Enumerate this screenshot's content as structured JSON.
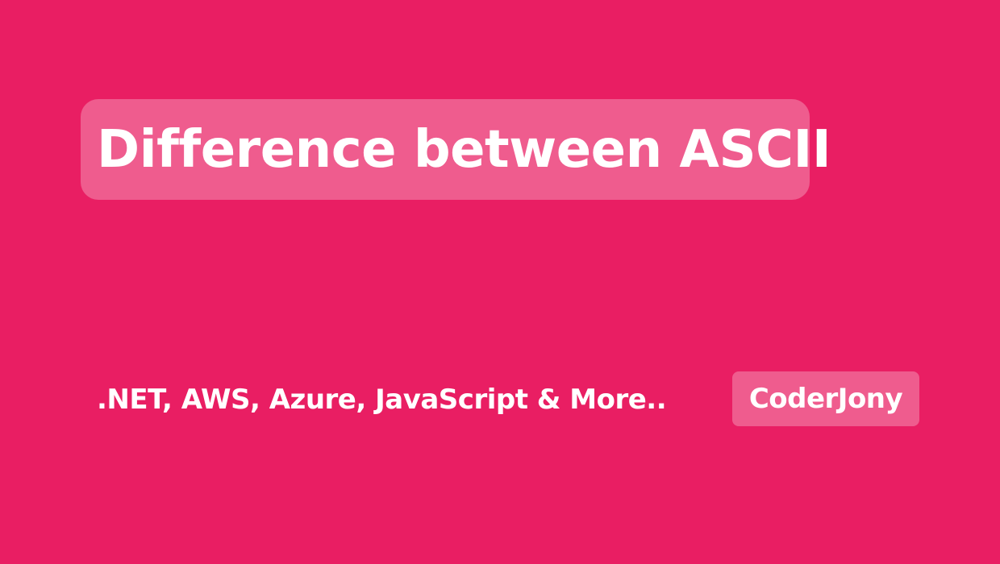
{
  "title": "Difference between ASCII",
  "tagline": ".NET, AWS, Azure, JavaScript & More..",
  "brand": "CoderJony",
  "colors": {
    "background": "#e91e63",
    "text": "#ffffff",
    "box_overlay": "rgba(255,255,255,0.28)"
  }
}
